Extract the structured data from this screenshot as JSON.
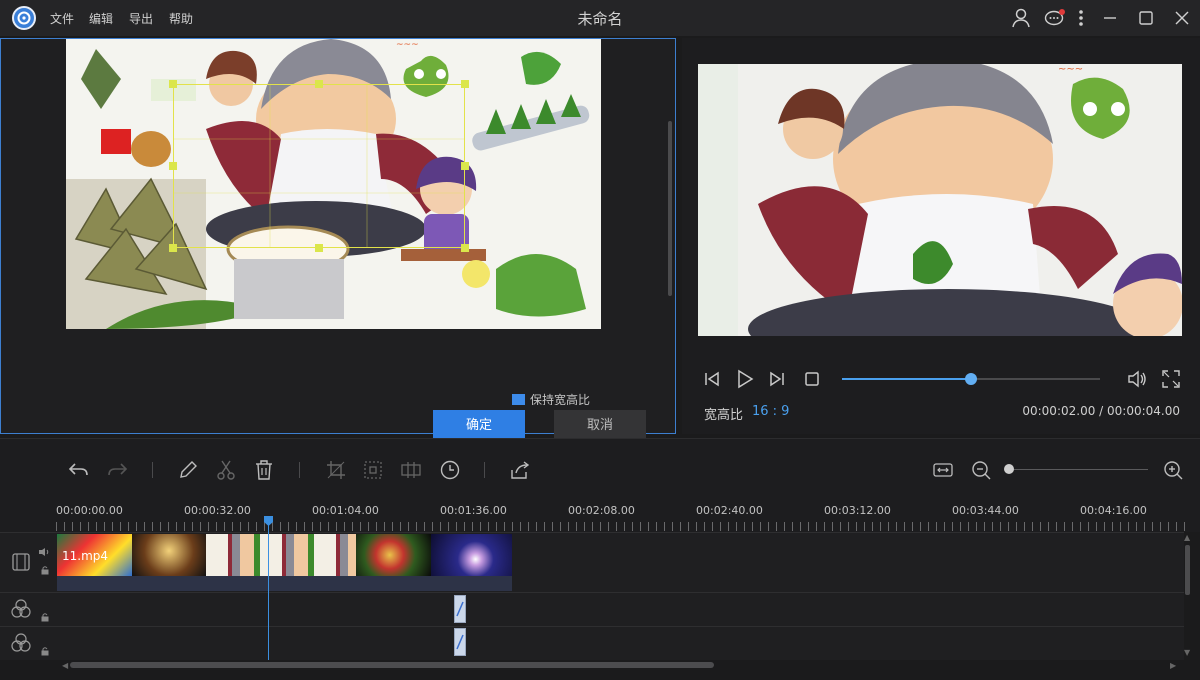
{
  "app": {
    "title": "未命名",
    "menu": [
      "文件",
      "编辑",
      "导出",
      "帮助"
    ]
  },
  "editor": {
    "keep_ratio_label": "保持宽高比",
    "keep_ratio_checked": true,
    "ok_label": "确定",
    "cancel_label": "取消"
  },
  "preview": {
    "ratio_label": "宽高比",
    "ratio_value": "16 : 9",
    "time_display": "00:00:02.00 / 00:00:04.00",
    "progress": 0.5
  },
  "timeline": {
    "ruler_labels": [
      "00:00:00.00",
      "00:00:32.00",
      "00:01:04.00",
      "00:01:36.00",
      "00:02:08.00",
      "00:02:40.00",
      "00:03:12.00",
      "00:03:44.00",
      "00:04:16.00"
    ],
    "clip_name": "11.mp4",
    "zoom_level": 0
  },
  "colors": {
    "accent": "#2f7fe4",
    "crop_handle": "#dbe64b",
    "playhead": "#3b8fe0",
    "notification_dot": "#e03a3a"
  }
}
